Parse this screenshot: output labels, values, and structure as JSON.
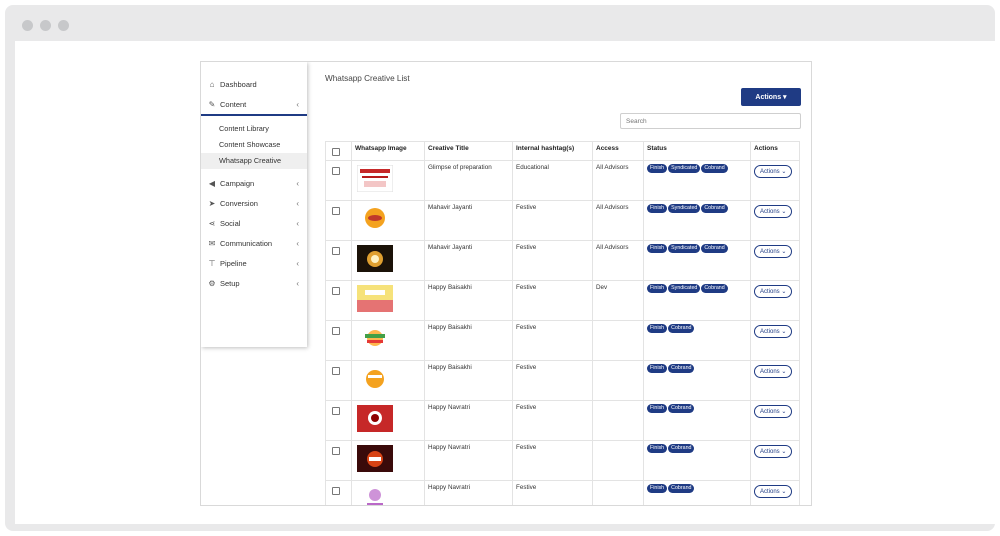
{
  "sidebar": {
    "items": [
      {
        "label": "Dashboard",
        "icon": "home-icon",
        "glyph": "⌂"
      },
      {
        "label": "Content",
        "icon": "edit-icon",
        "glyph": "✎",
        "chevron": "‹"
      },
      {
        "label": "Campaign",
        "icon": "megaphone-icon",
        "glyph": "📢",
        "chevron": "‹"
      },
      {
        "label": "Conversion",
        "icon": "cursor-icon",
        "glyph": "➤",
        "chevron": "‹"
      },
      {
        "label": "Social",
        "icon": "share-icon",
        "glyph": "⋖",
        "chevron": "‹"
      },
      {
        "label": "Communication",
        "icon": "mail-icon",
        "glyph": "✉",
        "chevron": "‹"
      },
      {
        "label": "Pipeline",
        "icon": "filter-icon",
        "glyph": "⊤",
        "chevron": "‹"
      },
      {
        "label": "Setup",
        "icon": "gear-icon",
        "glyph": "⚙",
        "chevron": "‹"
      }
    ],
    "subitems": [
      "Content Library",
      "Content Showcase",
      "Whatsapp Creative"
    ]
  },
  "main": {
    "title": "Whatsapp Creative List",
    "actions_label": "Actions ▾",
    "search_placeholder": "Search",
    "columns": [
      "Whatsapp Image",
      "Creative Title",
      "Internal hashtag(s)",
      "Access",
      "Status",
      "Actions"
    ],
    "row_action_label": "Actions ⌄",
    "rows": [
      {
        "title": "Glimpse of preparation",
        "hashtag": "Educational",
        "access": "All Advisors",
        "status": [
          "Finish",
          "Syndicated",
          "Cobrand"
        ]
      },
      {
        "title": "Mahavir Jayanti",
        "hashtag": "Festive",
        "access": "All Advisors",
        "status": [
          "Finish",
          "Syndicated",
          "Cobrand"
        ]
      },
      {
        "title": "Mahavir Jayanti",
        "hashtag": "Festive",
        "access": "All Advisors",
        "status": [
          "Finish",
          "Syndicated",
          "Cobrand"
        ]
      },
      {
        "title": "Happy Baisakhi",
        "hashtag": "Festive",
        "access": "Dev",
        "status": [
          "Finish",
          "Syndicated",
          "Cobrand"
        ]
      },
      {
        "title": "Happy Baisakhi",
        "hashtag": "Festive",
        "access": "",
        "status": [
          "Finish",
          "Cobrand"
        ]
      },
      {
        "title": "Happy Baisakhi",
        "hashtag": "Festive",
        "access": "",
        "status": [
          "Finish",
          "Cobrand"
        ]
      },
      {
        "title": "Happy Navratri",
        "hashtag": "Festive",
        "access": "",
        "status": [
          "Finish",
          "Cobrand"
        ]
      },
      {
        "title": "Happy Navratri",
        "hashtag": "Festive",
        "access": "",
        "status": [
          "Finish",
          "Cobrand"
        ]
      },
      {
        "title": "Happy Navratri",
        "hashtag": "Festive",
        "access": "",
        "status": [
          "Finish",
          "Cobrand"
        ]
      }
    ]
  },
  "colors": {
    "accent": "#1f3b84"
  }
}
